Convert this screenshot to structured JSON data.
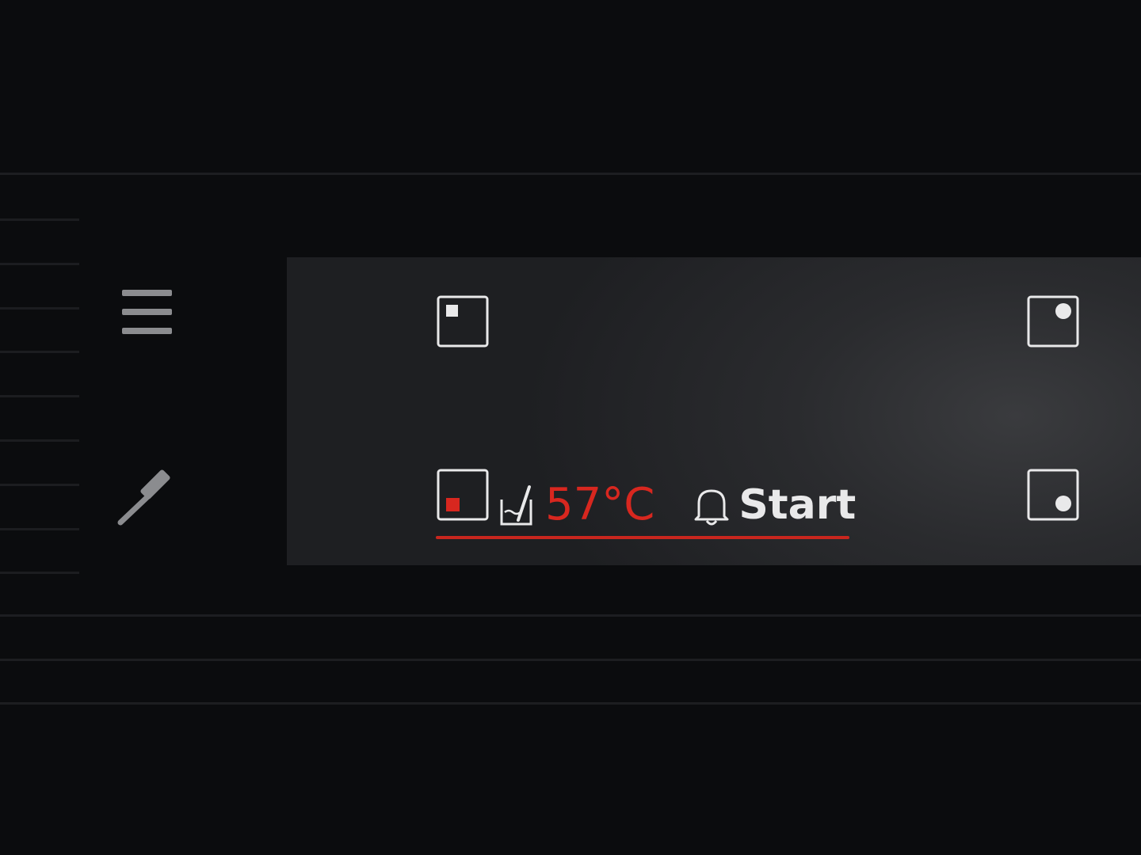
{
  "status": {
    "temperature": "57°C",
    "start_label": "Start"
  },
  "colors": {
    "accent": "#d8271f",
    "panel": "#2a2b2e",
    "background": "#0b0c0e",
    "icon": "#e9e9ea",
    "muted_icon": "#8b8c8f"
  },
  "icons": {
    "menu": "hamburger-menu-icon",
    "probe": "food-probe-icon",
    "probe_temperature": "probe-temperature-icon",
    "bell": "bell-icon"
  }
}
